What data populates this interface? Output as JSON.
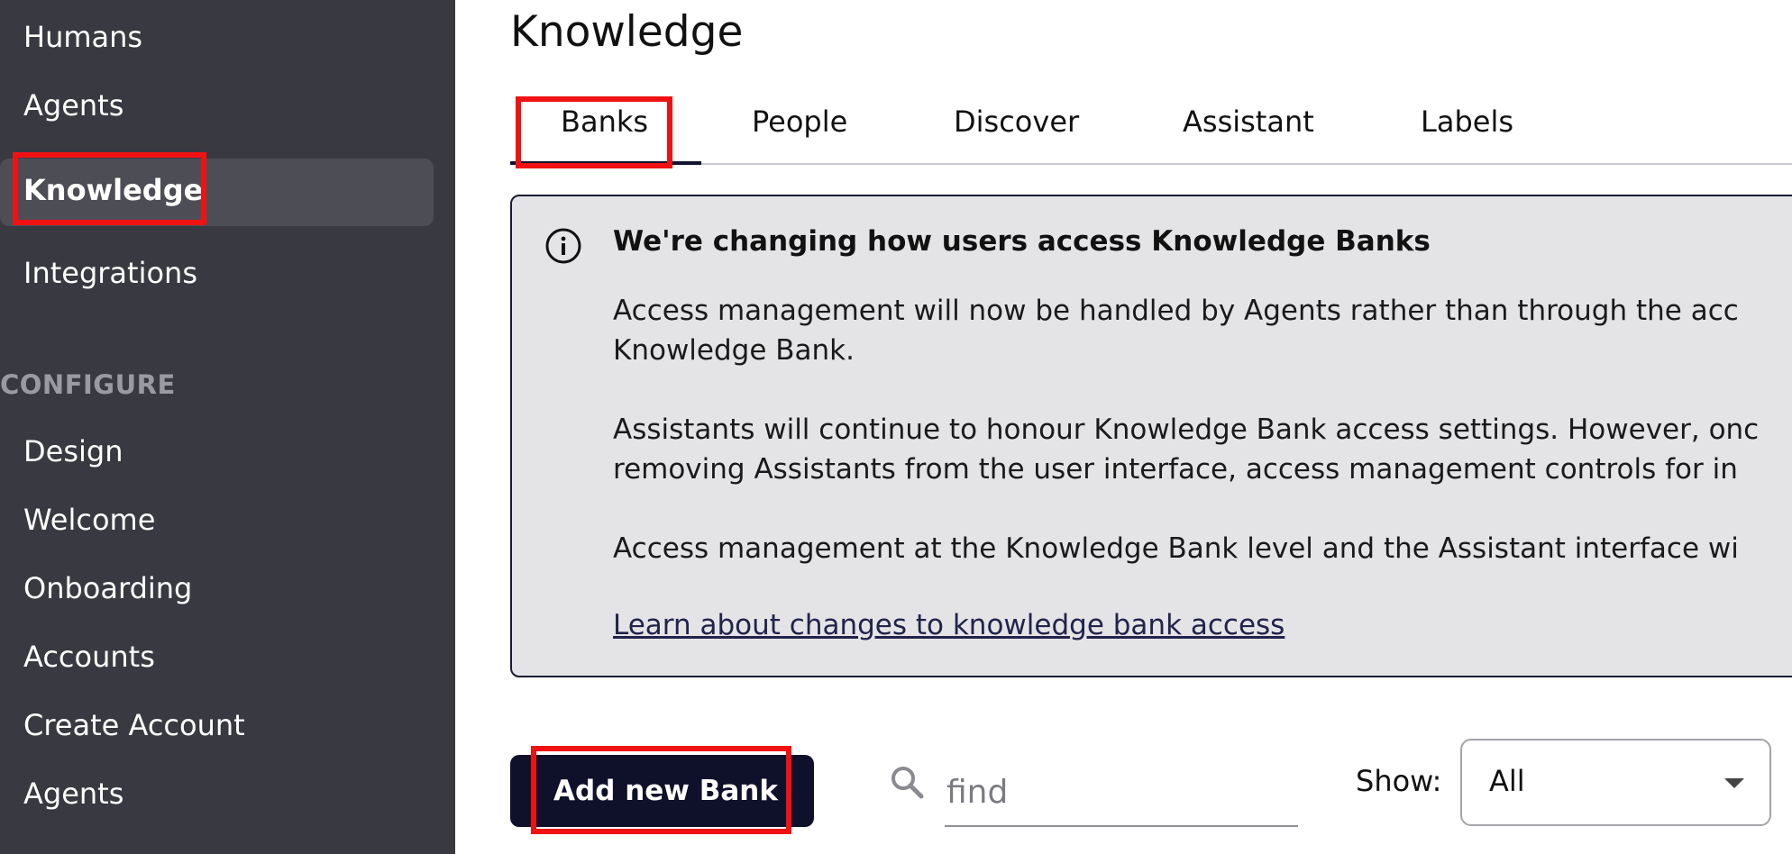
{
  "sidebar": {
    "items": [
      {
        "label": "Humans"
      },
      {
        "label": "Agents"
      },
      {
        "label": "Knowledge"
      },
      {
        "label": "Integrations"
      }
    ],
    "section_label": "CONFIGURE",
    "configure_items": [
      {
        "label": "Design"
      },
      {
        "label": "Welcome"
      },
      {
        "label": "Onboarding"
      },
      {
        "label": "Accounts"
      },
      {
        "label": "Create Account"
      },
      {
        "label": "Agents"
      }
    ],
    "active_item": "Knowledge"
  },
  "main": {
    "title": "Knowledge",
    "tabs": [
      {
        "label": "Banks"
      },
      {
        "label": "People"
      },
      {
        "label": "Discover"
      },
      {
        "label": "Assistant"
      },
      {
        "label": "Labels"
      }
    ],
    "active_tab": "Banks",
    "notice": {
      "icon": "info-icon",
      "title": "We're changing how users access Knowledge Banks",
      "lines": [
        "Access management will now be handled by Agents rather than through the acc",
        "Knowledge Bank.",
        "Assistants will continue to honour Knowledge Bank access settings. However, onc",
        "removing Assistants from the user interface, access management controls for in",
        "Access management at the Knowledge Bank level and the Assistant interface wi"
      ],
      "link": "Learn about changes to knowledge bank access"
    },
    "toolbar": {
      "add_button": "Add new Bank",
      "search_placeholder": "find",
      "show_label": "Show:",
      "show_value": "All"
    }
  },
  "colors": {
    "sidebar_bg": "#393941",
    "sidebar_active_bg": "#4d4d55",
    "primary_button": "#0f1029",
    "notice_bg": "#e4e4e7",
    "highlight": "#f01212"
  }
}
